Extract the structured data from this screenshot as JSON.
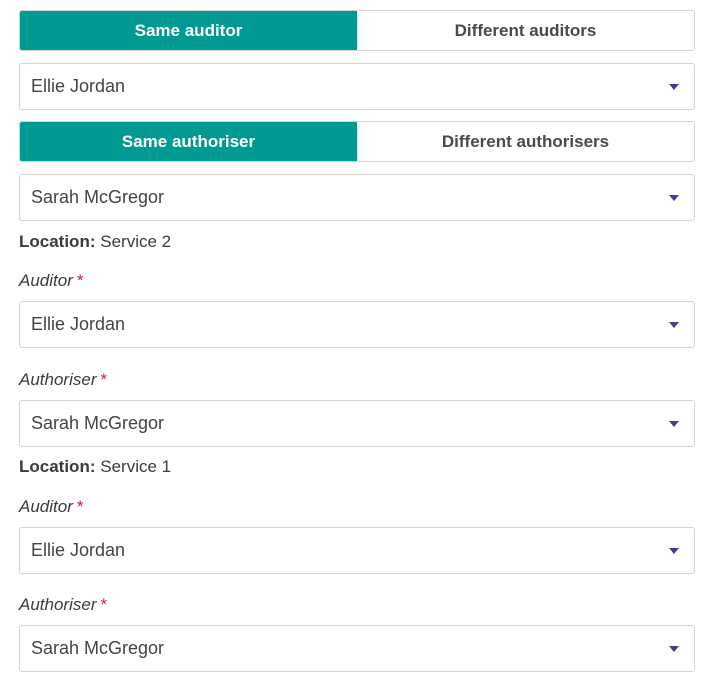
{
  "auditor_toggle": {
    "same_label": "Same auditor",
    "different_label": "Different auditors",
    "selected": "same"
  },
  "auditor_all": {
    "value": "Ellie Jordan"
  },
  "authoriser_toggle": {
    "same_label": "Same authoriser",
    "different_label": "Different authorisers",
    "selected": "same"
  },
  "authoriser_all": {
    "value": "Sarah McGregor"
  },
  "locations": [
    {
      "prefix": "Location:",
      "name": "Service 2",
      "auditor_label": "Auditor",
      "auditor_value": "Ellie Jordan",
      "authoriser_label": "Authoriser",
      "authoriser_value": "Sarah McGregor"
    },
    {
      "prefix": "Location:",
      "name": "Service 1",
      "auditor_label": "Auditor",
      "auditor_value": "Ellie Jordan",
      "authoriser_label": "Authoriser",
      "authoriser_value": "Sarah McGregor"
    }
  ],
  "required_marker": "*",
  "colors": {
    "accent": "#009a93",
    "required": "#c2185b",
    "caret": "#4b3a8c"
  }
}
